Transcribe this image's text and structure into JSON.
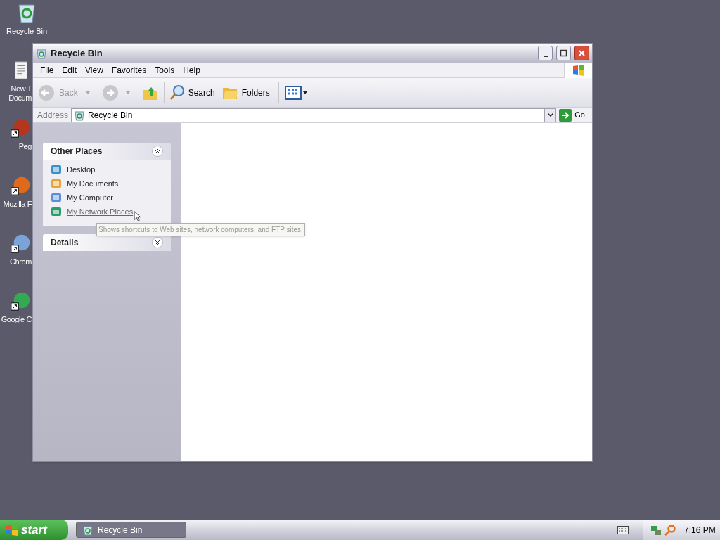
{
  "desktop_icons": [
    {
      "label": "Recycle Bin",
      "clipped": false
    },
    {
      "label": "New T Docum",
      "clipped": true
    },
    {
      "label": "Peg",
      "clipped": true
    },
    {
      "label": "Mozilla F",
      "clipped": true
    },
    {
      "label": "Chrom",
      "clipped": true
    },
    {
      "label": "Google C",
      "clipped": true
    }
  ],
  "window": {
    "title": "Recycle Bin"
  },
  "menu": [
    "File",
    "Edit",
    "View",
    "Favorites",
    "Tools",
    "Help"
  ],
  "toolbar": {
    "back": "Back",
    "search": "Search",
    "folders": "Folders"
  },
  "address": {
    "label": "Address",
    "value": "Recycle Bin",
    "go": "Go"
  },
  "panels": [
    {
      "title": "Other Places",
      "expanded": true,
      "items": [
        {
          "label": "Desktop",
          "hovered": false
        },
        {
          "label": "My Documents",
          "hovered": false
        },
        {
          "label": "My Computer",
          "hovered": false
        },
        {
          "label": "My Network Places",
          "hovered": true
        }
      ]
    },
    {
      "title": "Details",
      "expanded": false
    }
  ],
  "tooltip": "Shows shortcuts to Web sites, network computers, and FTP sites.",
  "taskbar": {
    "start": "start",
    "tasks": [
      {
        "label": "Recycle Bin",
        "selected": false
      }
    ],
    "clock": "7:16 PM"
  }
}
